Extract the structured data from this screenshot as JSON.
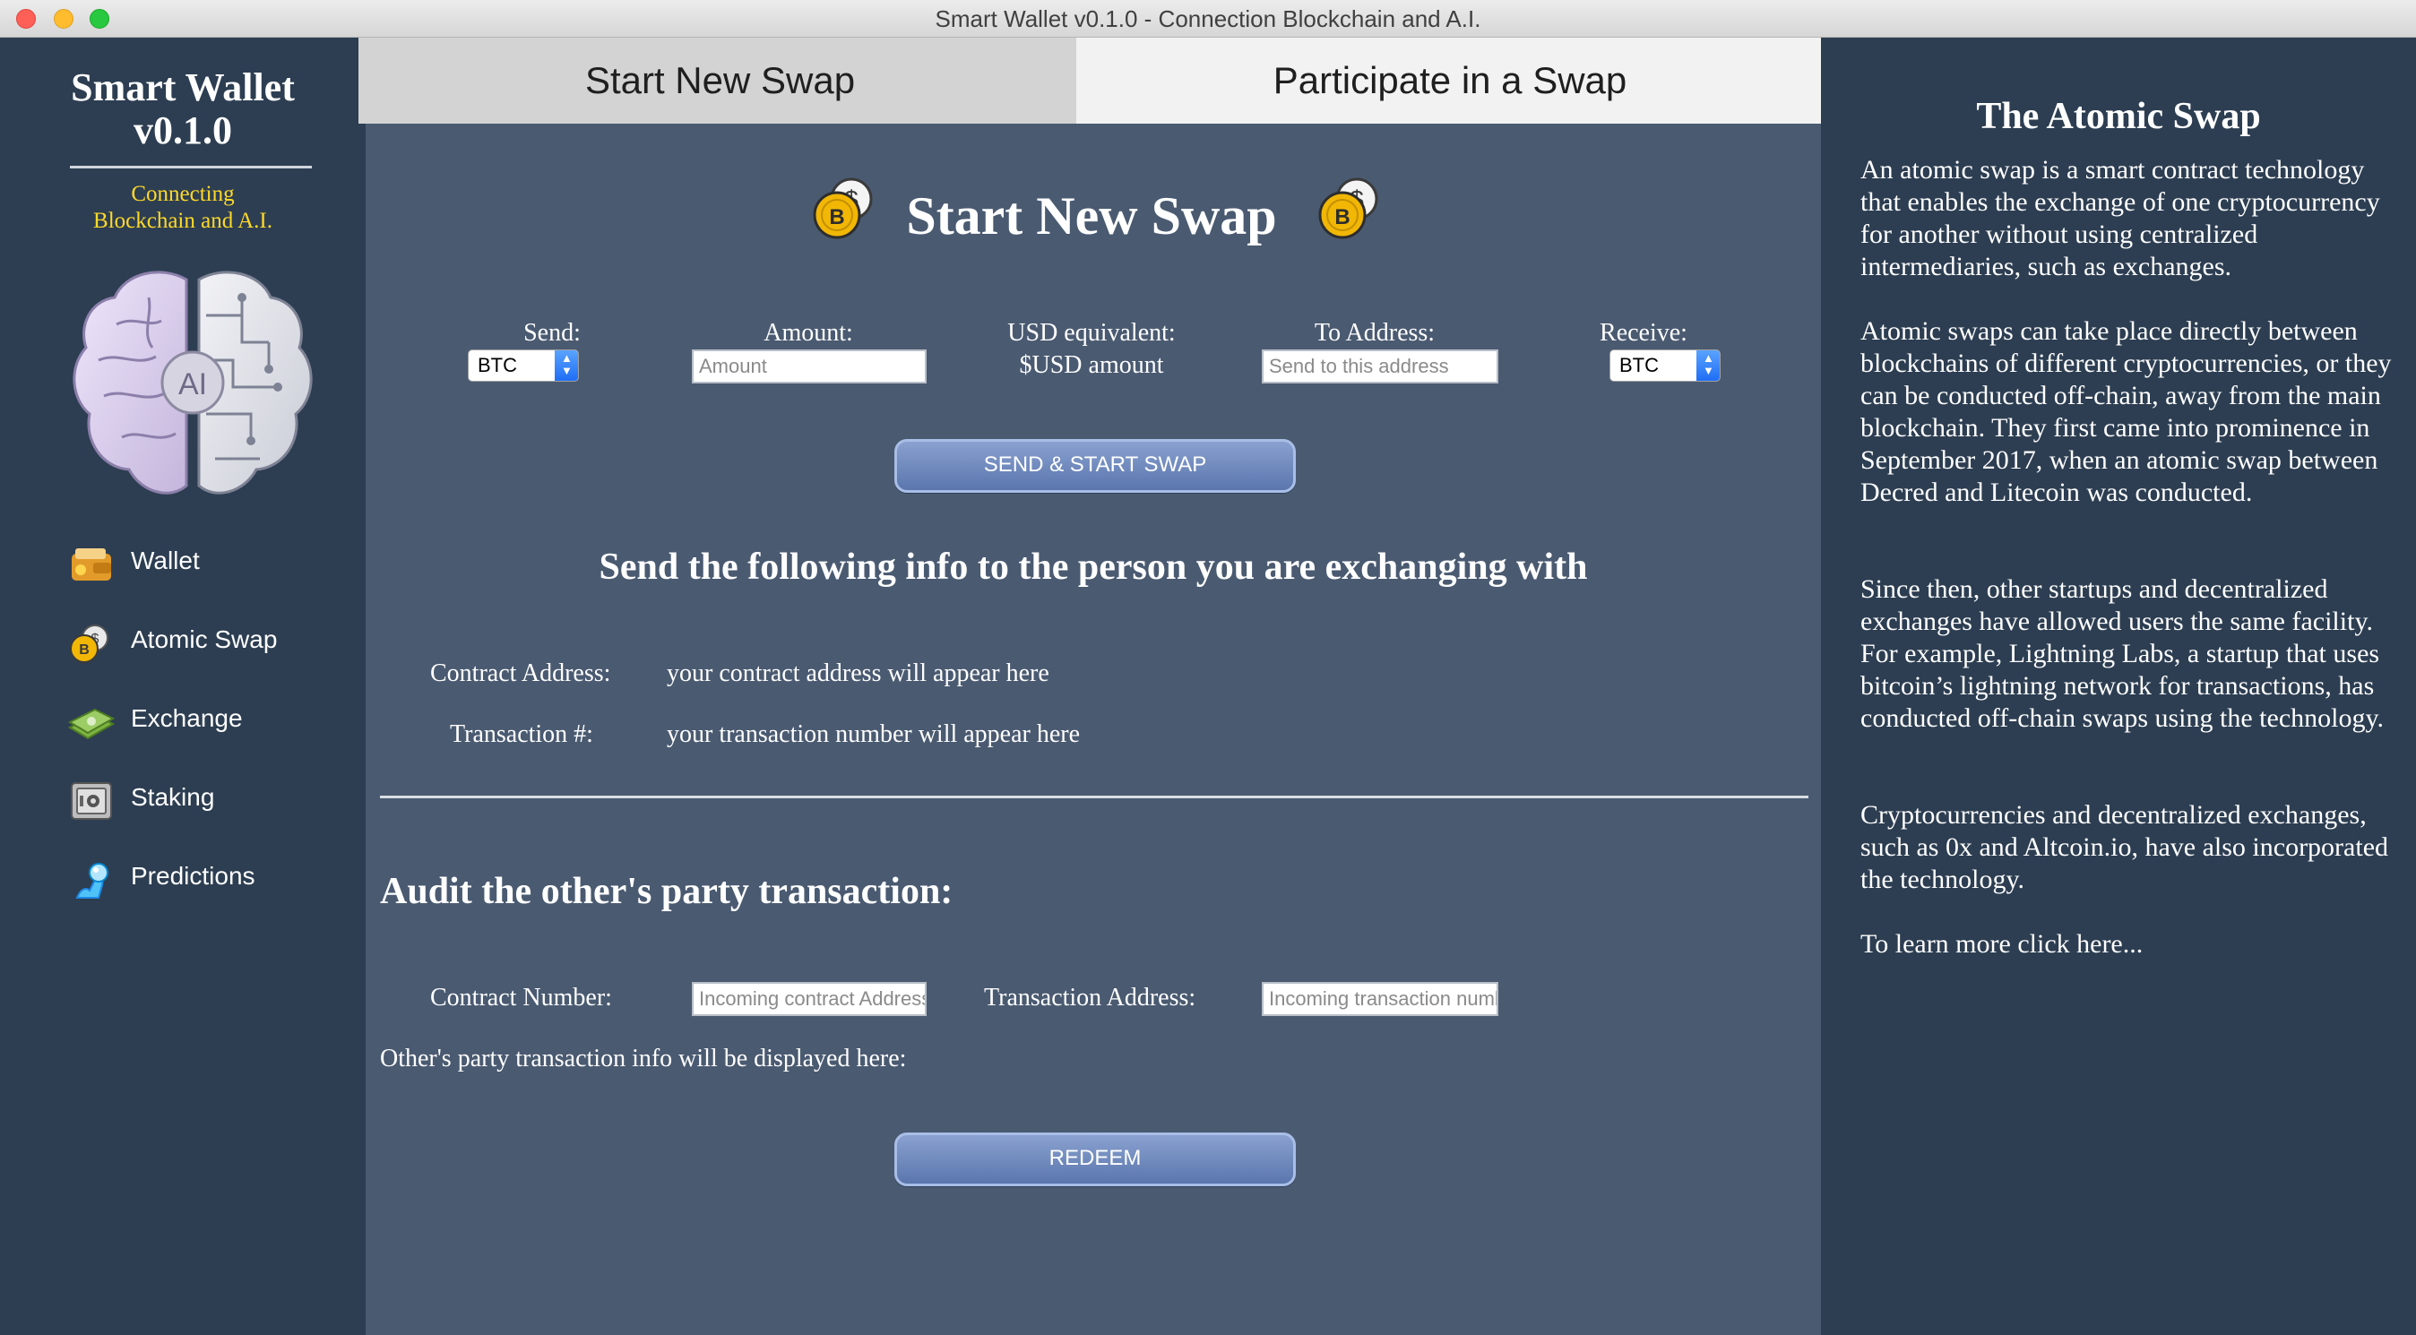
{
  "window": {
    "title": "Smart Wallet v0.1.0 - Connection Blockchain and A.I."
  },
  "sidebar": {
    "brand_line1": "Smart Wallet",
    "brand_line2": "v0.1.0",
    "tagline_line1": "Connecting",
    "tagline_line2": "Blockchain and A.I.",
    "brain_label": "AI",
    "items": [
      {
        "label": "Wallet",
        "icon": "wallet-icon"
      },
      {
        "label": "Atomic Swap",
        "icon": "bitcoin-coins-icon"
      },
      {
        "label": "Exchange",
        "icon": "money-stack-icon"
      },
      {
        "label": "Staking",
        "icon": "safe-icon"
      },
      {
        "label": "Predictions",
        "icon": "crystal-ball-icon"
      }
    ]
  },
  "tabs": [
    {
      "label": "Start New Swap",
      "selected": true
    },
    {
      "label": "Participate in a Swap",
      "selected": false
    }
  ],
  "main": {
    "title": "Start New Swap",
    "send_label": "Send:",
    "send_value": "BTC",
    "amount_label": "Amount:",
    "amount_placeholder": "Amount",
    "usd_label": "USD equivalent:",
    "usd_value": "$USD amount",
    "to_address_label": "To Address:",
    "to_address_placeholder": "Send to this address",
    "receive_label": "Receive:",
    "receive_value": "BTC",
    "send_button": "SEND & START SWAP",
    "info_heading": "Send the following info to the person you are exchanging with",
    "contract_address_label": "Contract Address:",
    "contract_address_value": "your contract address will appear here",
    "transaction_label": "Transaction #:",
    "transaction_value": "your transaction number will appear here",
    "audit_heading": "Audit the other's party transaction:",
    "contract_number_label": "Contract Number:",
    "contract_number_placeholder": "Incoming contract Address",
    "transaction_address_label": "Transaction Address:",
    "transaction_address_placeholder": "Incoming transaction number",
    "audit_info": "Other's party transaction info will be displayed here:",
    "redeem_button": "REDEEM"
  },
  "info_panel": {
    "title": "The Atomic Swap",
    "paragraphs": [
      "An atomic swap is a smart contract technology that enables the exchange of one cryptocurrency for another without using centralized intermediaries, such as exchanges.",
      "Atomic swaps can take place directly between blockchains of different cryptocurrencies, or they can be conducted off-chain, away from the main blockchain. They first came into prominence in September 2017, when an atomic swap between Decred and Litecoin was conducted.",
      "Since then, other startups and decentralized exchanges have allowed users the same facility. For example, Lightning Labs, a startup that uses bitcoin’s lightning network for transactions, has conducted off-chain swaps using the technology.",
      "Cryptocurrencies and decentralized exchanges, such as 0x and Altcoin.io, have also incorporated the technology."
    ],
    "learn_more": "To learn more click here..."
  },
  "colors": {
    "sidebar_bg": "#2d3e52",
    "main_bg": "#4a5a71",
    "tagline": "#ffd928",
    "button": "#6d86bb",
    "coin_gold": "#f2b705"
  }
}
